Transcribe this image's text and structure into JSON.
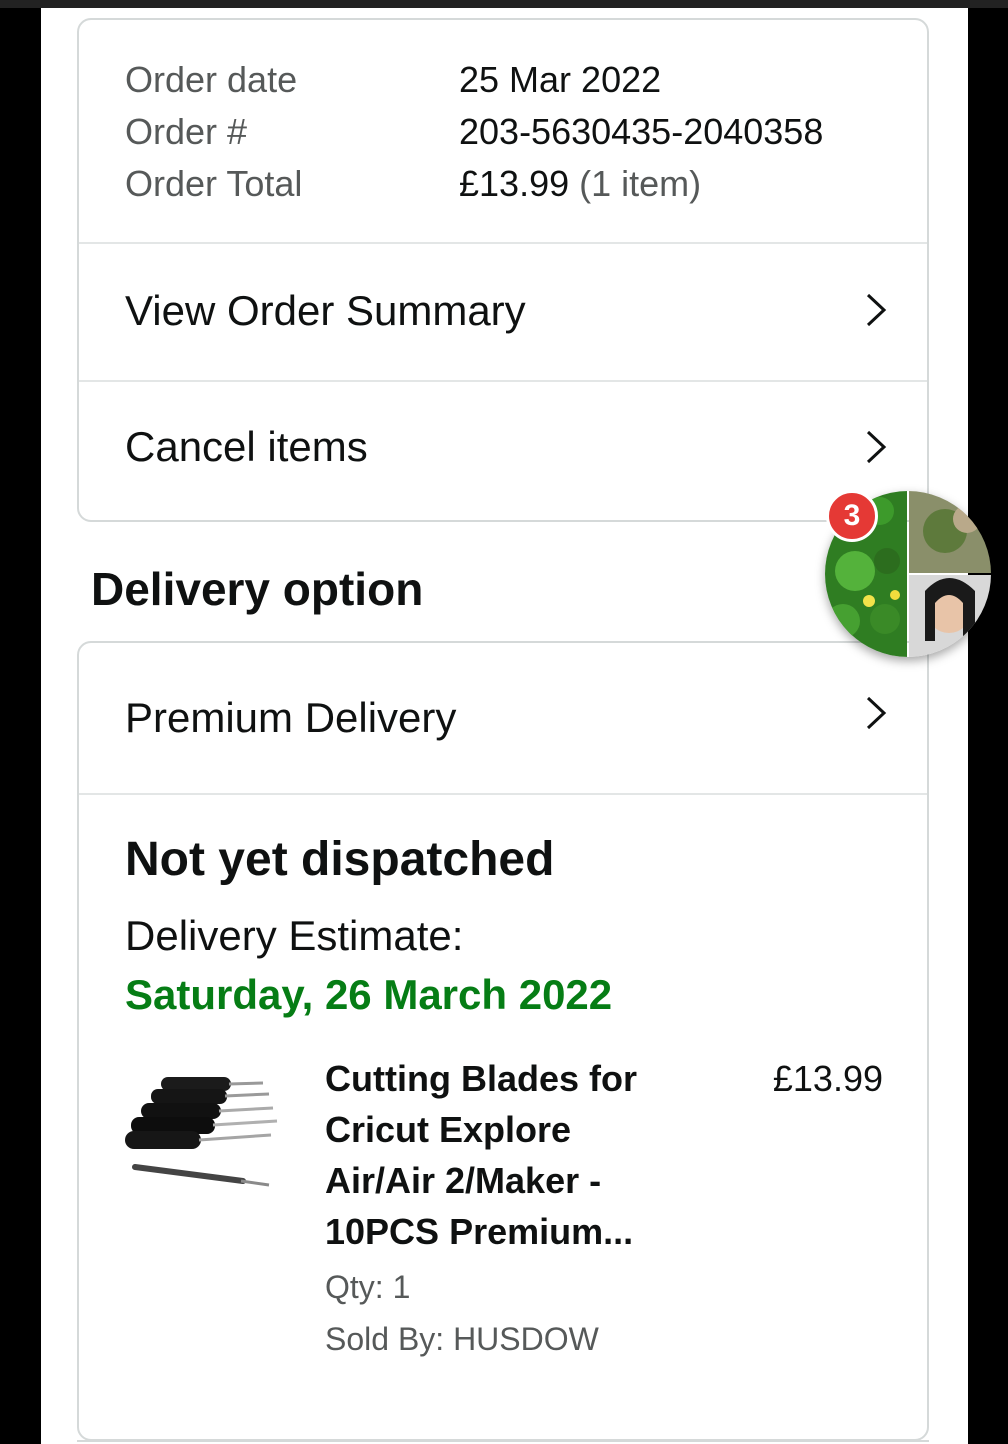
{
  "order": {
    "date_label": "Order date",
    "date_value": "25 Mar 2022",
    "number_label": "Order #",
    "number_value": "203-5630435-2040358",
    "total_label": "Order Total",
    "total_value": "£13.99",
    "total_items": "(1 item)"
  },
  "actions": {
    "view_summary": "View Order Summary",
    "cancel_items": "Cancel items"
  },
  "delivery": {
    "section_title": "Delivery option",
    "option_label": "Premium Delivery",
    "status": "Not yet dispatched",
    "estimate_label": "Delivery Estimate:",
    "estimate_date": "Saturday, 26 March 2022"
  },
  "product": {
    "title": "Cutting Blades for Cricut Explore Air/Air 2/Maker - 10PCS Premium...",
    "price": "£13.99",
    "qty": "Qty: 1",
    "seller": "Sold By: HUSDOW"
  },
  "chat_heads": {
    "unread_count": "3"
  },
  "colors": {
    "accent_green": "#067d15",
    "badge_red": "#e53935",
    "border": "#d5d9d9"
  },
  "icons": [
    "chevron-right-icon",
    "cutting-blades-product-image",
    "chat-heads-bubble"
  ]
}
